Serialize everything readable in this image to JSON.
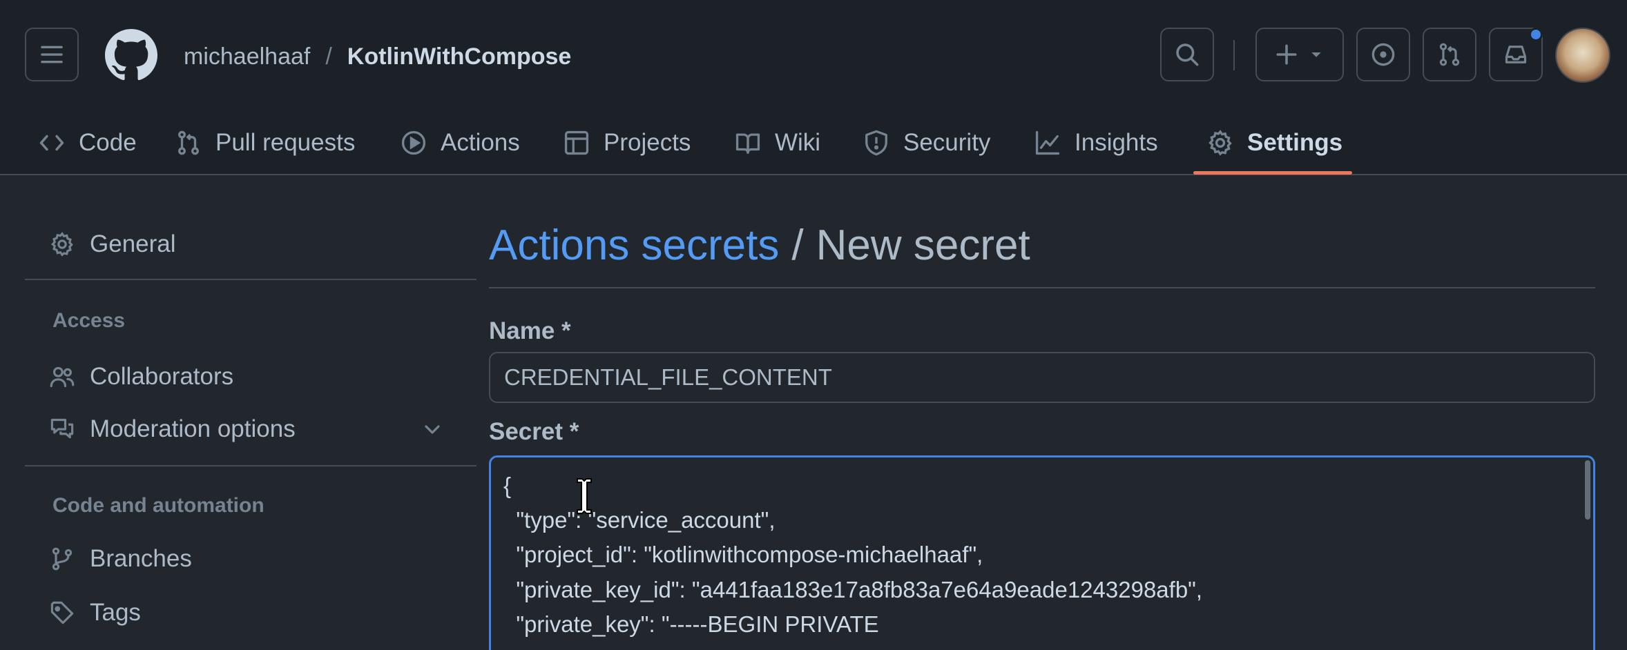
{
  "header": {
    "owner": "michaelhaaf",
    "separator": "/",
    "repo": "KotlinWithCompose"
  },
  "tabs": [
    {
      "label": "Code",
      "icon": "code-icon"
    },
    {
      "label": "Pull requests",
      "icon": "git-pull-request-icon"
    },
    {
      "label": "Actions",
      "icon": "play-icon"
    },
    {
      "label": "Projects",
      "icon": "table-icon"
    },
    {
      "label": "Wiki",
      "icon": "book-icon"
    },
    {
      "label": "Security",
      "icon": "shield-icon"
    },
    {
      "label": "Insights",
      "icon": "graph-icon"
    },
    {
      "label": "Settings",
      "icon": "gear-icon",
      "active": true
    }
  ],
  "sidebar": {
    "general": "General",
    "access_heading": "Access",
    "collaborators": "Collaborators",
    "moderation": "Moderation options",
    "code_heading": "Code and automation",
    "branches": "Branches",
    "tags": "Tags"
  },
  "main": {
    "crumb_link": "Actions secrets",
    "crumb_sep": "/",
    "crumb_current": "New secret",
    "name_label": "Name *",
    "name_value": "CREDENTIAL_FILE_CONTENT",
    "secret_label": "Secret *",
    "secret_lines": [
      "{",
      "  \"type\": \"service_account\",",
      "  \"project_id\": \"kotlinwithcompose-michaelhaaf\",",
      "  \"private_key_id\": \"a441faa183e17a8fb83a7e64a9eade1243298afb\",",
      "  \"private_key\": \"-----BEGIN PRIVATE"
    ]
  },
  "colors": {
    "accent": "#539bf5",
    "focus_border": "#4184e4",
    "active_tab_underline": "#ec775c",
    "notification_dot": "#4184e4"
  }
}
